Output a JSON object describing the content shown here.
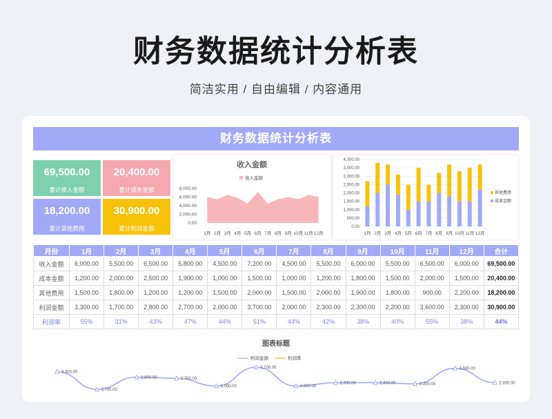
{
  "header": {
    "title": "财务数据统计分析表",
    "subtitle": "简洁实用 / 自由编辑 / 内容通用"
  },
  "banner": "财务数据统计分析表",
  "kpis": [
    {
      "value": "69,500.00",
      "label": "累计收入金额",
      "color": "#7ed0ae"
    },
    {
      "value": "20,400.00",
      "label": "累计成本金额",
      "color": "#f5a9ae"
    },
    {
      "value": "18,200.00",
      "label": "累计其他费用",
      "color": "#a1aaf7"
    },
    {
      "value": "30,900.00",
      "label": "累计利润金额",
      "color": "#f8c20a"
    }
  ],
  "table": {
    "headers": [
      "月份",
      "1月",
      "2月",
      "3月",
      "4月",
      "5月",
      "6月",
      "7月",
      "8月",
      "9月",
      "10月",
      "11月",
      "12月",
      "合计"
    ],
    "rows": [
      {
        "label": "收入金额",
        "cells": [
          "6,000.00",
          "5,500.00",
          "6,500.00",
          "5,800.00",
          "4,500.00",
          "7,200.00",
          "4,500.00",
          "5,500.00",
          "6,000.00",
          "5,500.00",
          "6,500.00",
          "6,000.00"
        ],
        "total": "69,500.00"
      },
      {
        "label": "成本金额",
        "cells": [
          "1,200.00",
          "2,000.00",
          "2,500.00",
          "1,900.00",
          "1,000.00",
          "1,500.00",
          "1,000.00",
          "1,200.00",
          "1,800.00",
          "1,500.00",
          "2,000.00",
          "1,500.00"
        ],
        "total": "20,400.00"
      },
      {
        "label": "其他费用",
        "cells": [
          "1,500.00",
          "1,800.00",
          "1,200.00",
          "1,200.00",
          "1,500.00",
          "2,000.00",
          "1,500.00",
          "2,000.00",
          "1,900.00",
          "1,800.00",
          "900.00",
          "2,200.00"
        ],
        "total": "18,200.00"
      },
      {
        "label": "利润金额",
        "cells": [
          "3,300.00",
          "1,700.00",
          "2,800.00",
          "2,700.00",
          "2,000.00",
          "3,700.00",
          "2,000.00",
          "2,300.00",
          "2,300.00",
          "2,200.00",
          "3,600.00",
          "2,300.00"
        ],
        "total": "30,900.00"
      },
      {
        "label": "利润率",
        "cells": [
          "55%",
          "31%",
          "43%",
          "47%",
          "44%",
          "51%",
          "44%",
          "42%",
          "38%",
          "40%",
          "55%",
          "38%"
        ],
        "total": "44%"
      }
    ]
  },
  "colors": {
    "income": "#f7b7b9",
    "stackBottom": "#a1aaf7",
    "stackTop": "#f8c20a",
    "profitLine": "#a1aaf7",
    "rateLine": "#f8c20a"
  },
  "chart_data": [
    {
      "type": "area",
      "title": "收入金额",
      "categories": [
        "1月",
        "2月",
        "3月",
        "4月",
        "5月",
        "6月",
        "7月",
        "8月",
        "9月",
        "10月",
        "11月",
        "12月"
      ],
      "series": [
        {
          "name": "收入金额",
          "values": [
            6000,
            5500,
            6500,
            5800,
            4500,
            7200,
            4500,
            5500,
            6000,
            5500,
            6500,
            6000
          ]
        }
      ],
      "ylim": [
        0,
        8000
      ],
      "yticks": [
        "0.00",
        "2,000.00",
        "4,000.00",
        "6,000.00",
        "8,000.00"
      ],
      "legend": "top"
    },
    {
      "type": "bar",
      "stacked": true,
      "categories": [
        "1月",
        "2月",
        "3月",
        "4月",
        "5月",
        "6月",
        "7月",
        "8月",
        "9月",
        "10月",
        "11月",
        "12月"
      ],
      "series": [
        {
          "name": "成本金额",
          "values": [
            1200,
            2000,
            2500,
            1900,
            1000,
            1500,
            1500,
            2000,
            1800,
            1500,
            1500,
            2200
          ]
        },
        {
          "name": "其他费用",
          "values": [
            1500,
            1800,
            1200,
            1200,
            1500,
            2000,
            1000,
            1200,
            1900,
            1800,
            2000,
            1500
          ]
        }
      ],
      "ylim": [
        0,
        4000
      ],
      "yticks": [
        "0.00",
        "500.00",
        "1,000.00",
        "1,500.00",
        "2,000.00",
        "2,500.00",
        "3,000.00",
        "3,500.00",
        "4,000.00"
      ],
      "legend": "right"
    },
    {
      "type": "line",
      "title": "图表标题",
      "categories": [
        "1月",
        "2月",
        "3月",
        "4月",
        "5月",
        "6月",
        "7月",
        "8月",
        "9月",
        "10月",
        "11月",
        "12月"
      ],
      "series": [
        {
          "name": "利润金额",
          "values": [
            3300,
            1700,
            2800,
            2700,
            2000,
            3700,
            2000,
            2300,
            2300,
            2200,
            3600,
            2300
          ]
        },
        {
          "name": "利润率",
          "values": []
        }
      ],
      "data_labels": [
        "3,300.00",
        "1,700.00",
        "2,800.00",
        "2,700.00",
        "2,000.00",
        "3,700.00",
        "2,000.00",
        "2,300.00",
        "2,300.00",
        "2,200.00",
        "3,600.00",
        "2,300.00"
      ],
      "legend": "top"
    }
  ]
}
